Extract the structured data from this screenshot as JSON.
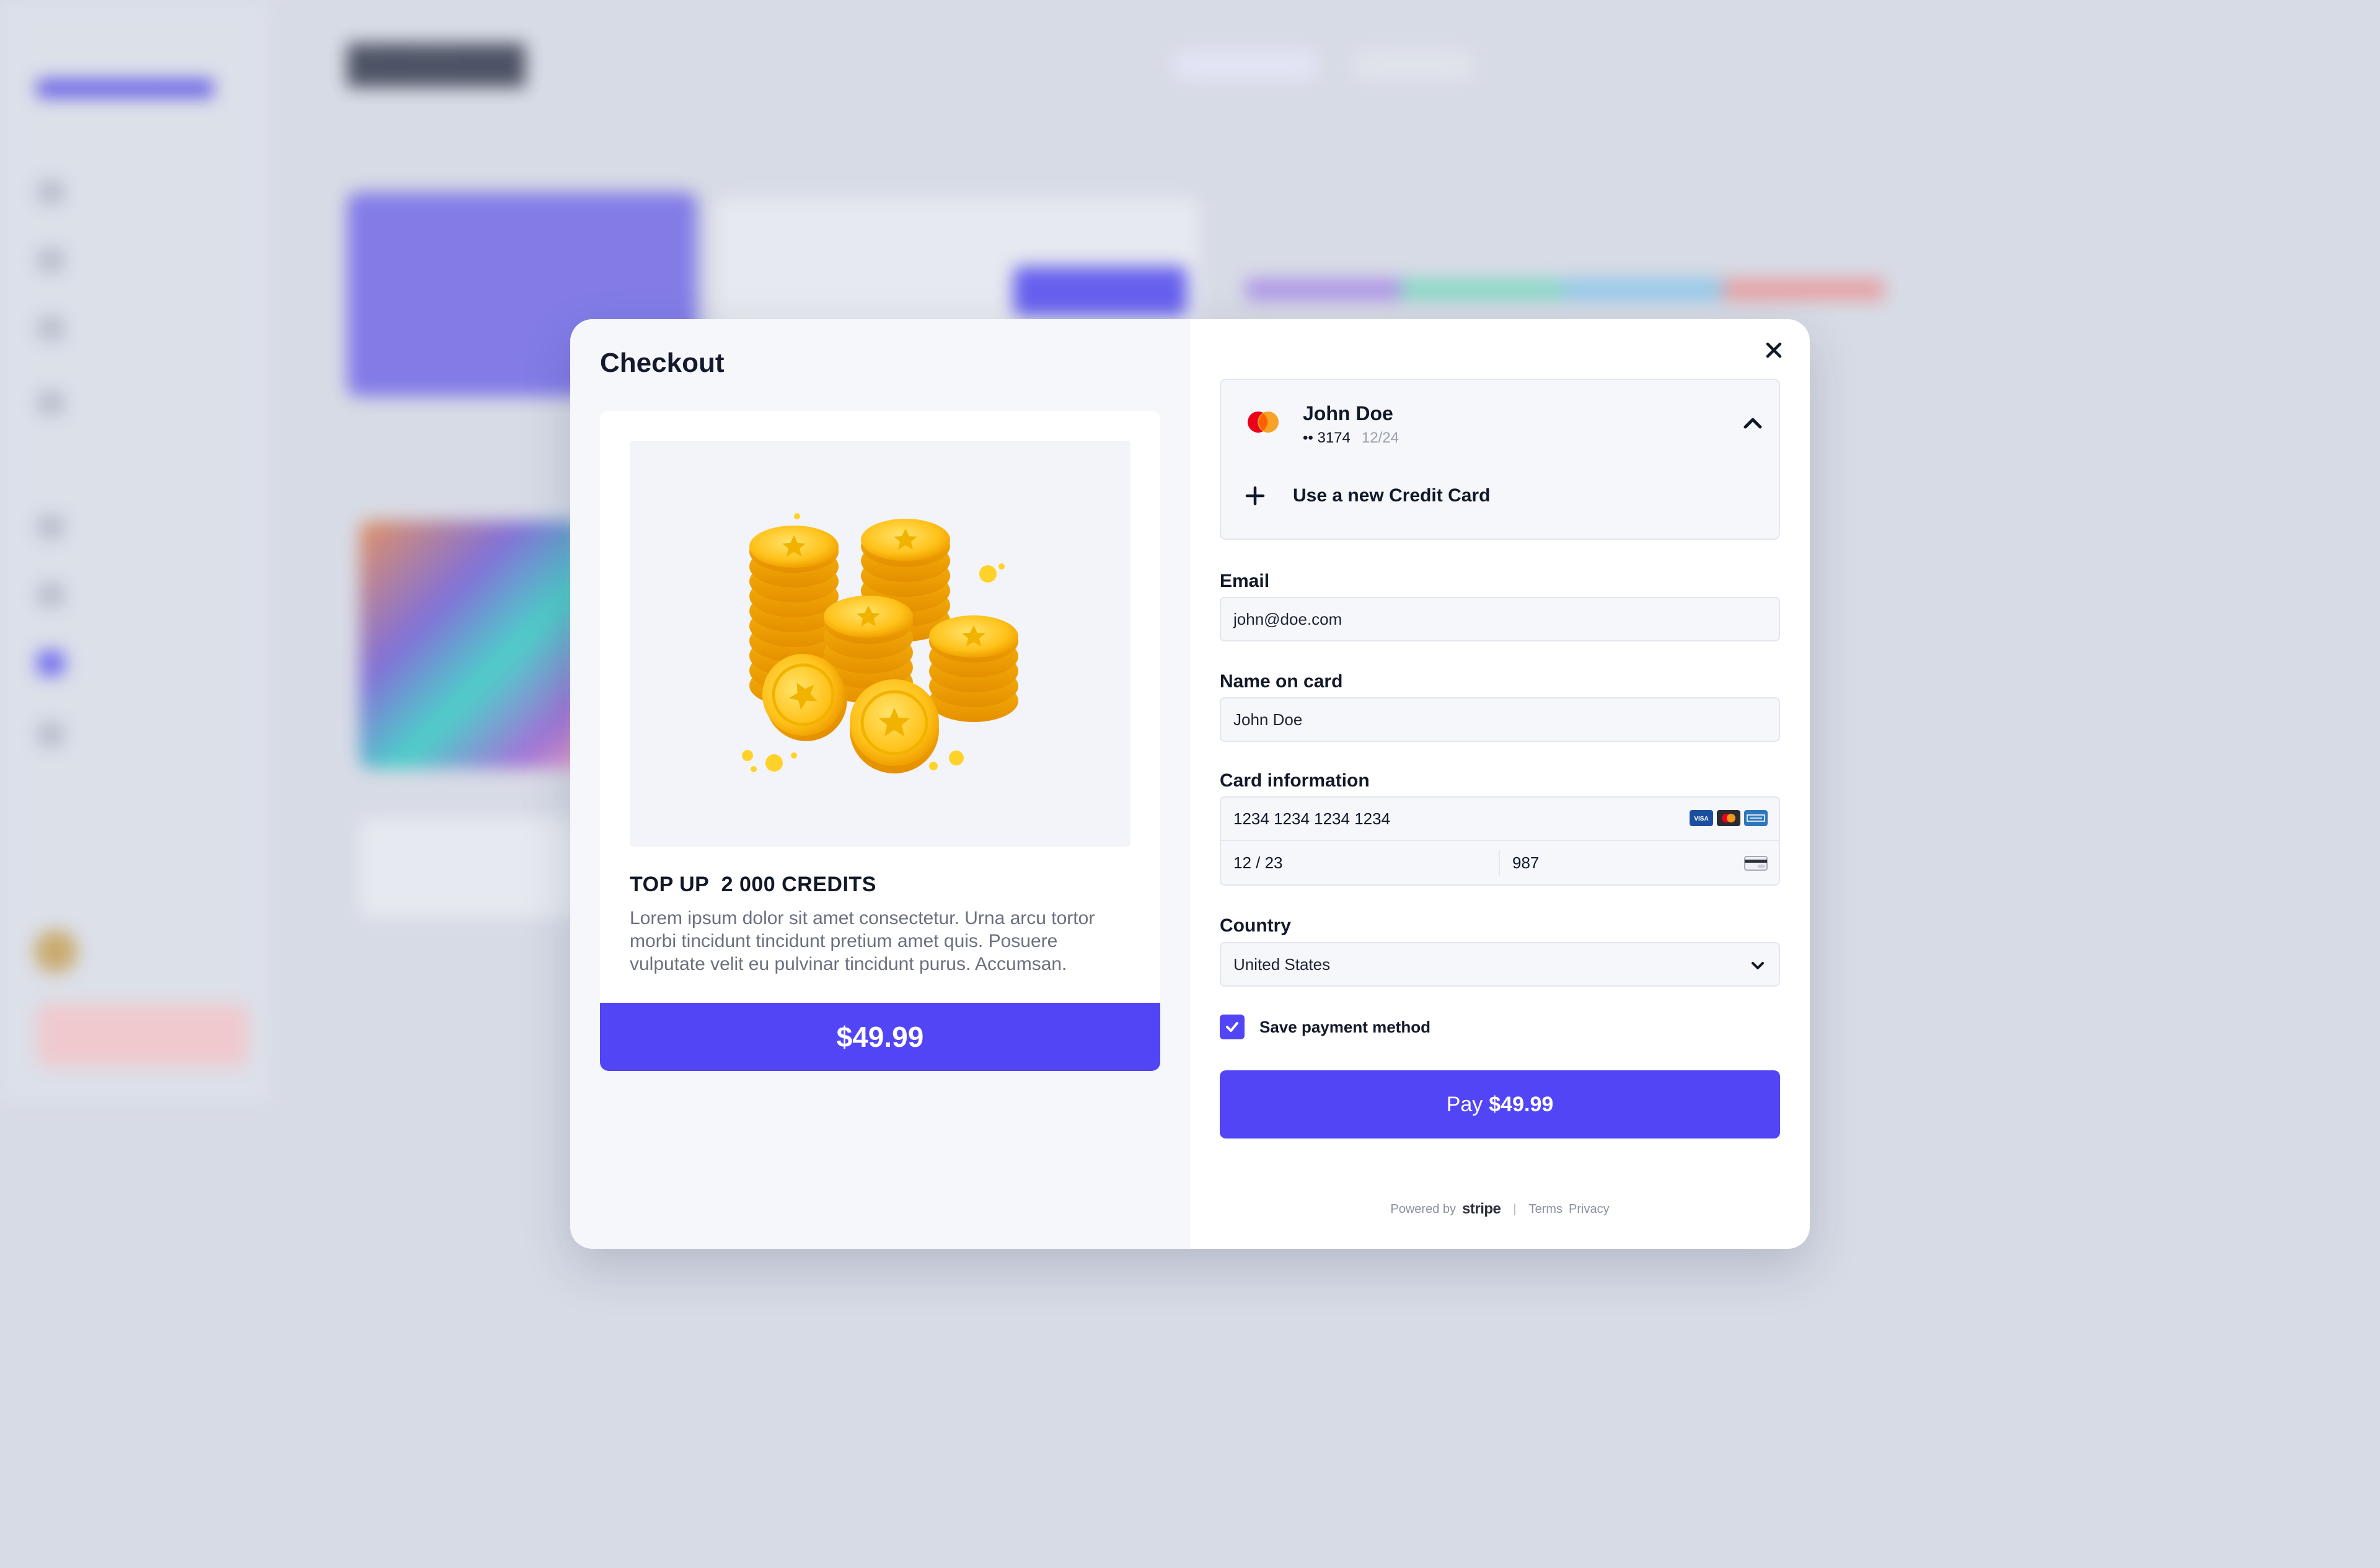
{
  "checkout": {
    "title": "Checkout",
    "product": {
      "image_icon": "gold-coins-stack",
      "title": "TOP UP  2 000 CREDITS",
      "description": "Lorem ipsum dolor sit amet consectetur. Urna arcu tortor morbi tincidunt tincidunt pretium amet quis. Posuere vulputate velit eu pulvinar tincidunt purus. Accumsan.",
      "price": "$49.99"
    },
    "saved_card": {
      "holder": "John Doe",
      "last4": "•• 3174",
      "expiry": "12/24",
      "brand_icon": "mastercard-icon",
      "expanded": true
    },
    "new_card_label": "Use a new Credit Card",
    "email": {
      "label": "Email",
      "value": "john@doe.com"
    },
    "name_on_card": {
      "label": "Name on card",
      "value": "John Doe"
    },
    "card_information": {
      "label": "Card information",
      "number": "1234 1234 1234 1234",
      "expiry": "12 / 23",
      "cvc": "987",
      "accepted_brands": [
        "visa-icon",
        "mastercard-icon",
        "amex-icon"
      ]
    },
    "country": {
      "label": "Country",
      "value": "United States"
    },
    "save_payment": {
      "label": "Save payment method",
      "checked": true
    },
    "pay_button": {
      "prefix": "Pay",
      "amount": "$49.99"
    },
    "footer": {
      "powered_by": "Powered by",
      "brand": "stripe",
      "separator": "|",
      "terms": "Terms",
      "privacy": "Privacy"
    }
  },
  "colors": {
    "accent": "#5145f6",
    "page_background": "#d7dbe5",
    "panel_left": "#f6f7fb",
    "text_primary": "#111827",
    "text_muted": "#6b7080"
  }
}
